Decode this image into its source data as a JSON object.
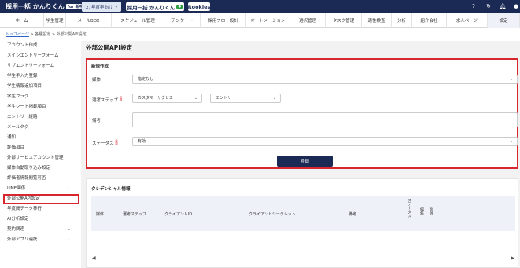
{
  "header": {
    "logo_main": "採用一括 かんりくん",
    "logo_tag": "for 新卒",
    "year_selector": "27年度卒向け",
    "logo_second": "採用一括 かんりくん",
    "logo_second_tag": "",
    "logo_rookies": "Rookies",
    "icons": [
      "help-icon",
      "refresh-icon",
      "bell-icon",
      "user-icon"
    ],
    "brand_color": "#1b2a55"
  },
  "nav": {
    "items": [
      "ホーム",
      "学生管理",
      "メールBOX",
      "スケジュール管理",
      "アンケート",
      "採用フロー設計",
      "オートメーション",
      "選択管理",
      "タスク管理",
      "適性検査",
      "分析",
      "紹介会社",
      "求人ページ",
      "設定"
    ],
    "active": "設定"
  },
  "breadcrumb": {
    "home": "トップページ",
    "sep1": ">",
    "level2": "各種設定",
    "sep2": ">",
    "current": "外部公開API設定"
  },
  "sidebar": {
    "items": [
      {
        "label": "アカウント作成",
        "chevron": ""
      },
      {
        "label": "メインエントリーフォーム",
        "chevron": ""
      },
      {
        "label": "サブエントリーフォーム",
        "chevron": ""
      },
      {
        "label": "学生手入力登録",
        "chevron": ""
      },
      {
        "label": "学生情報追加項目",
        "chevron": ""
      },
      {
        "label": "学生フラグ",
        "chevron": ""
      },
      {
        "label": "学生シート掲載項目",
        "chevron": ""
      },
      {
        "label": "エントリー経路",
        "chevron": ""
      },
      {
        "label": "メールタグ",
        "chevron": ""
      },
      {
        "label": "通知",
        "chevron": ""
      },
      {
        "label": "評価項目",
        "chevron": ""
      },
      {
        "label": "外部サービスアカウント管理",
        "chevron": ""
      },
      {
        "label": "媒体自動取り込み設定",
        "chevron": ""
      },
      {
        "label": "評価者情報閲覧可否",
        "chevron": ""
      },
      {
        "label": "LINE関係",
        "chevron": "⌄"
      },
      {
        "label": "外部公開API設定",
        "chevron": "",
        "active": true
      },
      {
        "label": "年度間データ移行",
        "chevron": ""
      },
      {
        "label": "AI分析設定",
        "chevron": ""
      },
      {
        "label": "契約関連",
        "chevron": "⌄"
      },
      {
        "label": "外部アプリ連携",
        "chevron": "⌄"
      }
    ]
  },
  "page_title": "外部公開API設定",
  "form": {
    "section_title": "新規作成",
    "media_label": "媒体",
    "media_value": "指定なし",
    "step_label": "選考ステップ",
    "required_mark": "必須",
    "step_value1": "カスタマーサクセス",
    "step_value2": "エントリー",
    "notes_label": "備考",
    "status_label": "ステータス",
    "status_value": "有効",
    "register_button": "登録",
    "highlight_color": "#d8262f"
  },
  "credentials": {
    "title": "クレデンシャル情報",
    "columns": [
      "媒体",
      "選考ステップ",
      "クライアントID",
      "クライアントシークレット",
      "備考",
      "ステータス",
      "編集",
      "削除"
    ],
    "rows": [],
    "scroll_left": "◀",
    "scroll_right": "▶"
  }
}
